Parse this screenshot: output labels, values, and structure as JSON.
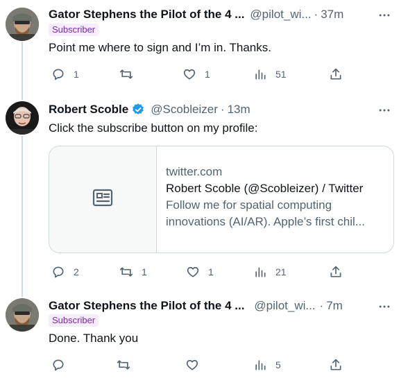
{
  "tweets": [
    {
      "name": "Gator Stephens the Pilot of the 4 ...",
      "handle": "@pilot_wi...",
      "separator": "·",
      "time": "37m",
      "badge": "Subscriber",
      "text": "Point me where to sign and I’m in.  Thanks.",
      "actions": {
        "reply": "1",
        "retweet": "",
        "like": "1",
        "views": "51"
      }
    },
    {
      "name": "Robert Scoble",
      "verified": true,
      "handle": "@Scobleizer",
      "separator": "·",
      "time": "13m",
      "text": "Click the subscribe button on my profile:",
      "card": {
        "domain": "twitter.com",
        "title": "Robert Scoble (@Scobleizer) / Twitter",
        "description_line1": "Follow me for spatial computing",
        "description_line2": "innovations (AI/AR). Apple’s first chil..."
      },
      "actions": {
        "reply": "2",
        "retweet": "1",
        "like": "1",
        "views": "21"
      }
    },
    {
      "name": "Gator Stephens the Pilot of the 4 ...",
      "handle": "@pilot_wi...",
      "separator": "·",
      "time": "7m",
      "badge": "Subscriber",
      "text": "Done. Thank you",
      "actions": {
        "reply": "",
        "retweet": "",
        "like": "",
        "views": "5"
      }
    }
  ],
  "icons": [
    "more-icon",
    "reply-icon",
    "retweet-icon",
    "like-icon",
    "views-icon",
    "share-icon",
    "verified-icon",
    "article-icon"
  ],
  "colors": {
    "text": "#0f1419",
    "muted": "#536471",
    "verified": "#1d9bf0",
    "badge_bg": "#f5edfb",
    "badge_text": "#7a27b0",
    "line": "#cfd9de"
  }
}
